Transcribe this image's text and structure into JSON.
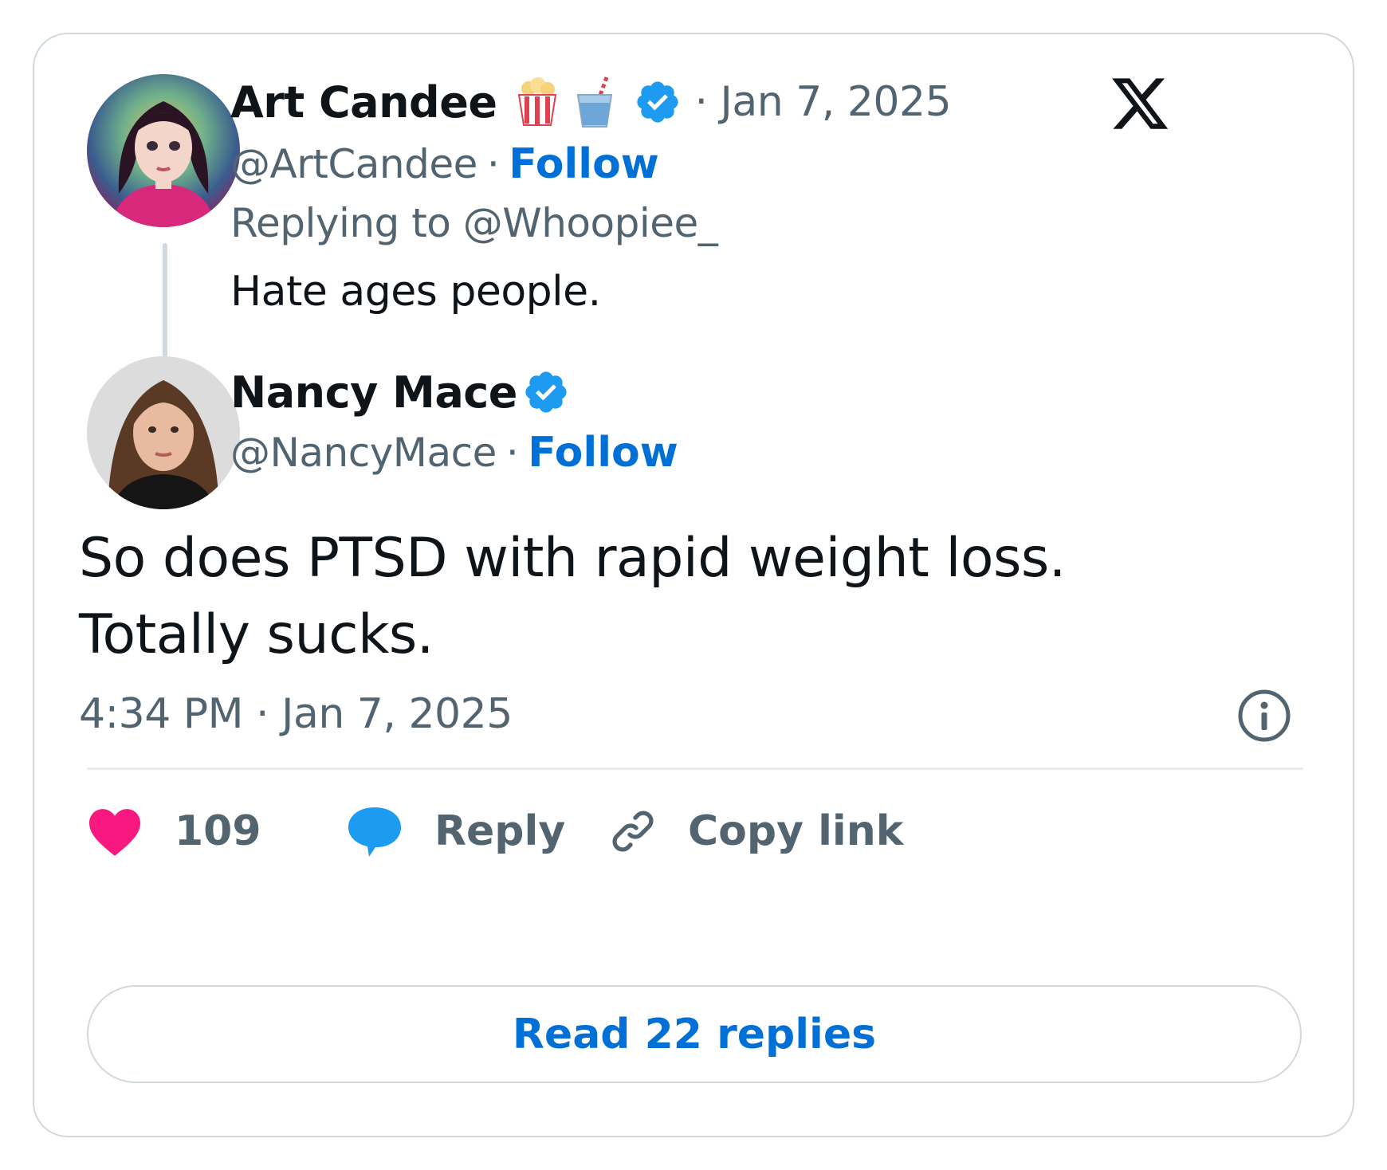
{
  "parent_tweet": {
    "author_name": "Art Candee",
    "name_emojis": [
      "popcorn-emoji",
      "cup-with-straw-emoji"
    ],
    "verified": true,
    "date": "· Jan 7, 2025",
    "handle": "@ArtCandee",
    "separator": "·",
    "follow_label": "Follow",
    "replying_to": "Replying to @Whoopiee_",
    "text": "Hate ages people."
  },
  "main_tweet": {
    "author_name": "Nancy Mace",
    "verified": true,
    "handle": "@NancyMace",
    "separator": "·",
    "follow_label": "Follow",
    "text_line1": "So does PTSD with rapid weight loss.",
    "text_line2": "Totally sucks.",
    "timestamp": "4:34 PM · Jan 7, 2025"
  },
  "actions": {
    "like_count": "109",
    "reply_label": "Reply",
    "copy_link_label": "Copy link"
  },
  "read_replies_label": "Read 22 replies",
  "icons": {
    "brand": "x-logo-icon",
    "info": "info-icon",
    "like": "heart-icon",
    "reply": "speech-bubble-icon",
    "copy": "link-icon",
    "verified": "verified-badge-icon"
  },
  "colors": {
    "accent_blue": "#006fd6",
    "verified_blue": "#1d9bf0",
    "like_pink": "#f91880",
    "text_primary": "#0f1419",
    "text_secondary": "#536471",
    "border": "#cfd9de"
  }
}
